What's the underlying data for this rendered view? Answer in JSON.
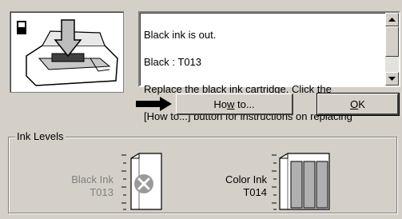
{
  "message": {
    "lines": [
      "Black ink is out.",
      "Black : T013",
      "Replace the black ink cartridge. Click the",
      "[How to...] button for instructions on replacing"
    ]
  },
  "buttons": {
    "howto_label_pre": "Ho",
    "howto_label_u": "w",
    "howto_label_post": " to...",
    "ok_label_u": "O",
    "ok_label_post": "K"
  },
  "ink_levels": {
    "group_label": "Ink Levels",
    "black": {
      "name": "Black Ink",
      "code": "T013",
      "status": "empty"
    },
    "color": {
      "name": "Color Ink",
      "code": "T014",
      "level": 1.0
    }
  },
  "colors": {
    "window_bg": "#d4d0c8",
    "color_ink_fill": "#b0b0b0",
    "disabled_text": "#808080"
  }
}
